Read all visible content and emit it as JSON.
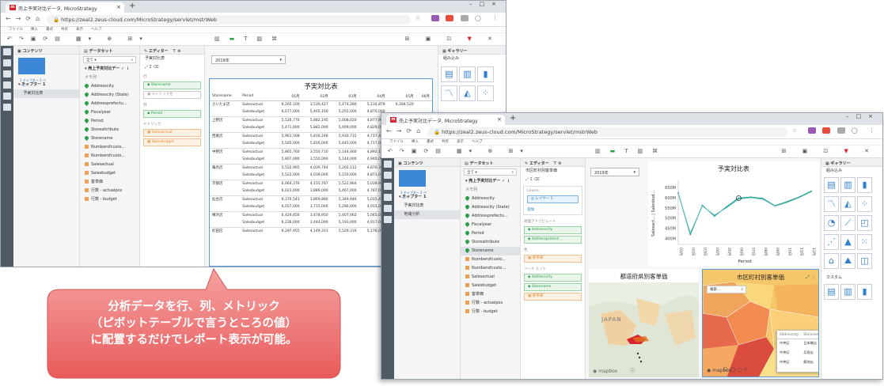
{
  "browser": {
    "tab_title": "売上予実対比データ, MicroStrategy",
    "url": "https://zeal2.zeus-cloud.com/MicroStrategy/servlet/mstrWeb",
    "menu": [
      "ファイル",
      "挿入",
      "書式",
      "共有",
      "表示",
      "ヘルプ"
    ],
    "favicon_letter": "m"
  },
  "contents_panel": {
    "title": "コンテンツ",
    "thumb_caption": "1 チャプター 1 ページ",
    "thumb_caption_2": "1 チャプター 2 ページ",
    "chapter": "チャプター 1",
    "page1": "予実対比表",
    "page2": "地域分析"
  },
  "dataset_panel": {
    "title": "データセット",
    "filter_value": "全て",
    "dataset_name": "売上予実対比デー",
    "memo": "メモ列",
    "items": [
      {
        "type": "attr",
        "label": "Addresscity"
      },
      {
        "type": "attr",
        "label": "Addresscity (State)"
      },
      {
        "type": "attr",
        "label": "Addressprefectu..."
      },
      {
        "type": "attr",
        "label": "Fiscalyear"
      },
      {
        "type": "attr",
        "label": "Period"
      },
      {
        "type": "attr",
        "label": "Storeattribute"
      },
      {
        "type": "attr",
        "label": "Storename"
      },
      {
        "type": "met",
        "label": "Numberofcusto..."
      },
      {
        "type": "met",
        "label": "Numberofcusto..."
      },
      {
        "type": "met",
        "label": "Salesactual"
      },
      {
        "type": "met",
        "label": "Salesbudget"
      },
      {
        "type": "met",
        "label": "客単価"
      },
      {
        "type": "met",
        "label": "行数 - actualpos"
      },
      {
        "type": "met",
        "label": "行数 - budget"
      }
    ]
  },
  "editor1": {
    "title": "エディター",
    "viz_name": "予実対比表",
    "row_label": "行",
    "row_items": [
      "Storename",
      "メトリック名"
    ],
    "col_label": "列",
    "col_items": [
      "Period"
    ],
    "metric_label": "メトリック",
    "metric_items": [
      "Salesactual",
      "Salesbudget"
    ]
  },
  "report": {
    "filter_value": "2019年",
    "title": "予実対比表",
    "headers": [
      "Storename",
      "Period",
      "01月",
      "02月",
      "03月",
      "04月",
      "05月",
      "06月"
    ],
    "rows": [
      [
        "さいたま店",
        "Salesactual",
        "6,265,100",
        "3,530,427",
        "5,474,280",
        "5,134,879",
        "6,284,520",
        ""
      ],
      [
        "",
        "Salesbudget",
        "6,077,000",
        "5,405,100",
        "5,255,000",
        "4,870,000",
        "",
        ""
      ],
      [
        "上野店",
        "Salesactual",
        "5,526,776",
        "5,882,195",
        "5,008,020",
        "4,877,977",
        "",
        ""
      ],
      [
        "",
        "Salesbudget",
        "5,471,000",
        "5,882,000",
        "5,009,000",
        "4,829,000",
        "",
        ""
      ],
      [
        "西葛店",
        "Salesactual",
        "5,961,568",
        "5,816,248",
        "5,930,732",
        "4,717,440",
        "",
        ""
      ],
      [
        "",
        "Salesbudget",
        "5,505,000",
        "5,816,000",
        "5,445,000",
        "4,717,000",
        "",
        ""
      ],
      [
        "中野店",
        "Salesactual",
        "5,865,760",
        "3,550,710",
        "5,144,460",
        "4,892,138",
        "",
        ""
      ],
      [
        "",
        "Salesbudget",
        "5,807,000",
        "3,550,000",
        "5,144,000",
        "4,940,000",
        "",
        ""
      ],
      [
        "亀有店",
        "Salesactual",
        "5,522,965",
        "4,039,744",
        "5,202,112",
        "4,870,340",
        "",
        ""
      ],
      [
        "",
        "Salesbudget",
        "5,522,000",
        "4,039,000",
        "5,150,000",
        "4,871,000",
        "",
        ""
      ],
      [
        "京都店",
        "Salesactual",
        "6,064,376",
        "4,155,767",
        "5,522,964",
        "5,039,980",
        "",
        ""
      ],
      [
        "",
        "Salesbudget",
        "6,023,000",
        "3,889,000",
        "5,467,000",
        "4,787,000",
        "",
        ""
      ],
      [
        "仙台店",
        "Salesactual",
        "6,376,543",
        "3,869,880",
        "5,349,946",
        "5,015,404",
        "",
        ""
      ],
      [
        "",
        "Salesbudget",
        "6,057,000",
        "3,715,000",
        "5,296,000",
        "4,915,000",
        "",
        ""
      ],
      [
        "横浜店",
        "Salesactual",
        "6,429,856",
        "3,478,950",
        "5,407,062",
        "5,065,046",
        "",
        ""
      ],
      [
        "",
        "Salesbudget",
        "6,236,000",
        "3,444,000",
        "5,193,000",
        "4,917,000",
        "",
        ""
      ],
      [
        "町田店",
        "Salesactual",
        "6,287,955",
        "4,149,331",
        "5,529,316",
        "5,176,000",
        "",
        ""
      ]
    ]
  },
  "gallery": {
    "title": "ギャラリー",
    "section": "組み込み",
    "custom": "カスタム"
  },
  "editor2": {
    "title": "エディター",
    "viz_name": "市区町村別客単価",
    "layers_label": "Layers",
    "layer_item": "レイヤー 1",
    "add_label": "追加",
    "geo_label": "地理アトリビュート",
    "geo_items": [
      "Addresscity",
      "Addressprefect..."
    ],
    "color_label": "色",
    "color_items": [
      "客単価"
    ],
    "tooltip_label": "ツール ヒント",
    "tooltip_items": [
      "Addresscity",
      "Storename",
      "客単価"
    ]
  },
  "window2": {
    "filter_value": "2019年",
    "line_title": "予実対比表",
    "map1_title": "都道府県別客単価",
    "map2_title": "市区町村別客単価",
    "map_search_placeholder": "検索...",
    "map_label_japan": "JAPAN",
    "mapbox": "mapbox",
    "tooltip_headers": [
      "Addresscity",
      "Storename",
      "客単価"
    ],
    "tooltip_rows": [
      [
        "中央区",
        "日本橋店",
        "2,124"
      ],
      [
        "中央区",
        "月島店",
        "2,147"
      ],
      [
        "中央区",
        "築地店",
        "870"
      ]
    ]
  },
  "chart_data": {
    "type": "line",
    "title": "予実対比表",
    "xlabel": "Period",
    "ylabel": "Salesact... | Salesbud...",
    "categories": [
      "01月",
      "02月",
      "03月",
      "04月",
      "05月",
      "06月",
      "07月",
      "08月",
      "09月",
      "10月",
      "11月",
      "12月"
    ],
    "y_ticks": [
      "400M",
      "450M",
      "500M",
      "550M",
      "600M",
      "650M"
    ],
    "ylim": [
      370,
      670
    ],
    "series": [
      {
        "name": "Salesactual",
        "color": "#0c9a8f",
        "values": [
          623,
          420,
          562,
          510,
          555,
          598,
          603,
          596,
          560,
          580,
          603,
          632
        ]
      },
      {
        "name": "Salesbudget",
        "color": "#7cc6bf",
        "values": [
          620,
          428,
          558,
          515,
          550,
          592,
          600,
          592,
          558,
          576,
          600,
          628
        ]
      }
    ]
  },
  "callout": {
    "line1": "分析データを行、列、メトリック",
    "line2": "（ピボットテーブルで言うところの値）",
    "line3": "に配置するだけでレポート表示が可能。"
  },
  "colors": {
    "brand": "#d9232e",
    "rail": "#505a64",
    "accent": "#1f6fb2",
    "callout": "#f07070"
  }
}
